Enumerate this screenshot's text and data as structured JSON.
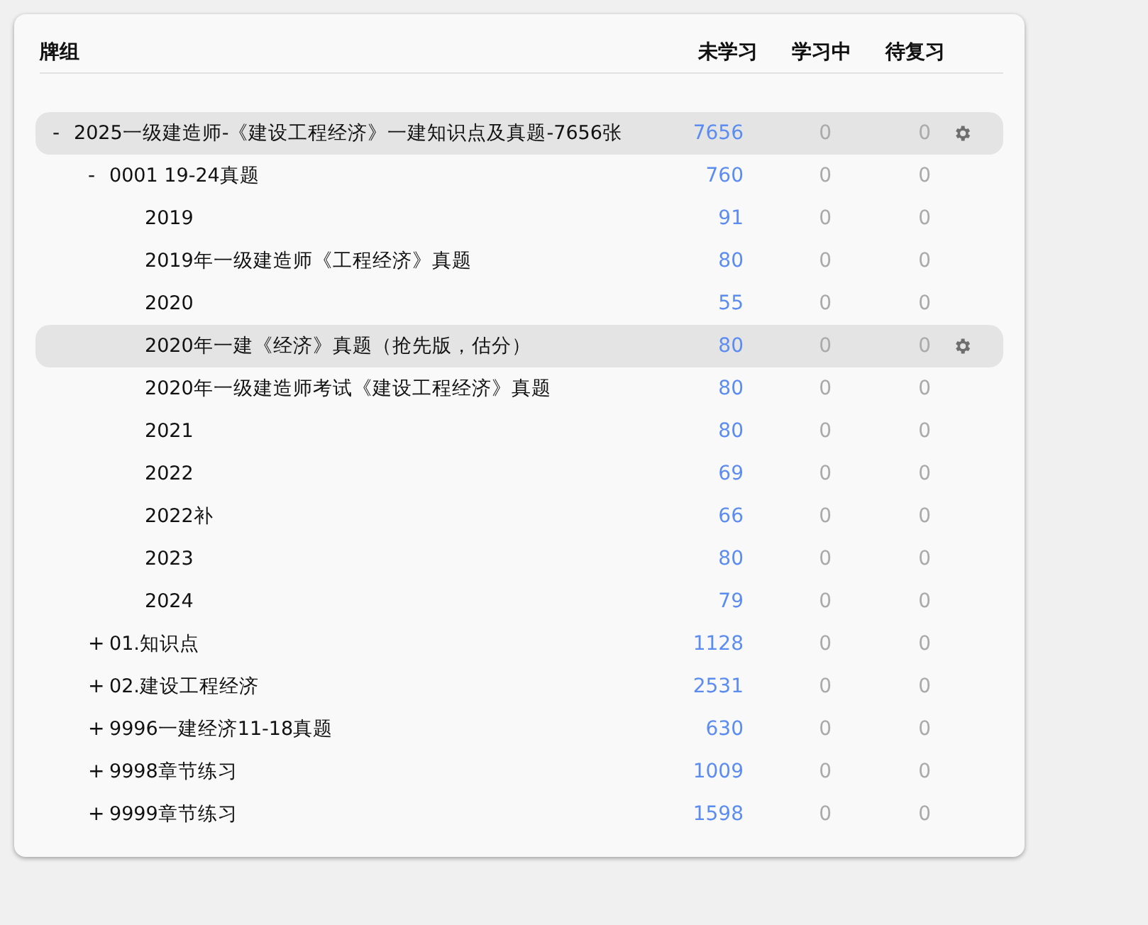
{
  "columns": {
    "name": "牌组",
    "new": "未学习",
    "learning": "学习中",
    "review": "待复习"
  },
  "decks": [
    {
      "toggle": "-",
      "name": "2025一级建造师-《建设工程经济》一建知识点及真题-7656张",
      "new": "7656",
      "learning": "0",
      "review": "0",
      "selected": true,
      "children": [
        {
          "toggle": "-",
          "name": "0001 19-24真题",
          "new": "760",
          "learning": "0",
          "review": "0",
          "selected": false,
          "children": [
            {
              "name": "2019",
              "new": "91",
              "learning": "0",
              "review": "0",
              "selected": false
            },
            {
              "name": "2019年一级建造师《工程经济》真题",
              "new": "80",
              "learning": "0",
              "review": "0",
              "selected": false
            },
            {
              "name": "2020",
              "new": "55",
              "learning": "0",
              "review": "0",
              "selected": false
            },
            {
              "name": "2020年一建《经济》真题（抢先版，估分）",
              "new": "80",
              "learning": "0",
              "review": "0",
              "selected": true
            },
            {
              "name": "2020年一级建造师考试《建设工程经济》真题",
              "new": "80",
              "learning": "0",
              "review": "0",
              "selected": false
            },
            {
              "name": "2021",
              "new": "80",
              "learning": "0",
              "review": "0",
              "selected": false
            },
            {
              "name": "2022",
              "new": "69",
              "learning": "0",
              "review": "0",
              "selected": false
            },
            {
              "name": "2022补",
              "new": "66",
              "learning": "0",
              "review": "0",
              "selected": false
            },
            {
              "name": "2023",
              "new": "80",
              "learning": "0",
              "review": "0",
              "selected": false
            },
            {
              "name": "2024",
              "new": "79",
              "learning": "0",
              "review": "0",
              "selected": false
            }
          ]
        },
        {
          "toggle": "+",
          "name": "01.知识点",
          "new": "1128",
          "learning": "0",
          "review": "0",
          "selected": false
        },
        {
          "toggle": "+",
          "name": "02.建设工程经济",
          "new": "2531",
          "learning": "0",
          "review": "0",
          "selected": false
        },
        {
          "toggle": "+",
          "name": "9996一建经济11-18真题",
          "new": "630",
          "learning": "0",
          "review": "0",
          "selected": false
        },
        {
          "toggle": "+",
          "name": "9998章节练习",
          "new": "1009",
          "learning": "0",
          "review": "0",
          "selected": false
        },
        {
          "toggle": "+",
          "name": "9999章节练习",
          "new": "1598",
          "learning": "0",
          "review": "0",
          "selected": false
        }
      ]
    }
  ]
}
